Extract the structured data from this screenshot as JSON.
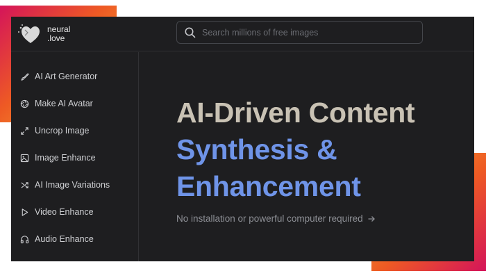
{
  "brand": {
    "name_line1": "neural",
    "name_line2": ".love"
  },
  "search": {
    "placeholder": "Search millions of free images"
  },
  "sidebar": {
    "items": [
      {
        "label": "AI Art Generator",
        "icon": "brush-icon"
      },
      {
        "label": "Make AI Avatar",
        "icon": "aperture-icon"
      },
      {
        "label": "Uncrop Image",
        "icon": "expand-arrows-icon"
      },
      {
        "label": "Image Enhance",
        "icon": "image-icon"
      },
      {
        "label": "AI Image Variations",
        "icon": "shuffle-icon"
      },
      {
        "label": "Video Enhance",
        "icon": "play-icon"
      },
      {
        "label": "Audio Enhance",
        "icon": "headphones-icon"
      }
    ]
  },
  "hero": {
    "line1": "AI-Driven Content",
    "line2": "Synthesis &",
    "line3": "Enhancement",
    "subtitle": "No installation or powerful computer required"
  },
  "colors": {
    "background": "#1e1e20",
    "hero_title": "#c9c2b4",
    "hero_accent": "#6f94e8",
    "text_muted": "#8d8f95",
    "gradient_pink": "#d4145a",
    "gradient_orange": "#ee5a24",
    "gradient_yellow": "#f7b731"
  }
}
